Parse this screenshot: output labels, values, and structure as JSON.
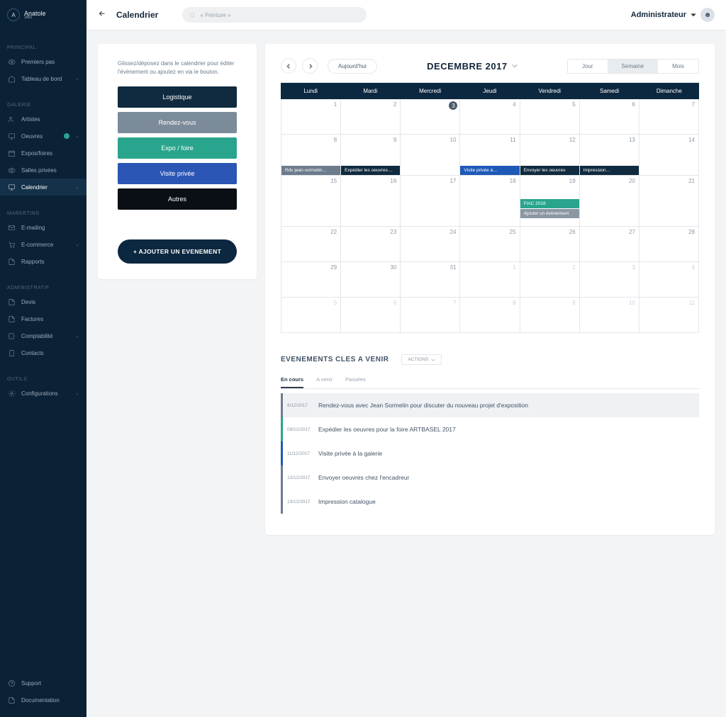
{
  "brand": {
    "name": "Anatole",
    "sub": "1883"
  },
  "header": {
    "page_title": "Calendrier",
    "search_placeholder": "« Peinture »",
    "user_label": "Administrateur"
  },
  "sidebar": {
    "sections": [
      {
        "title": "PRINCIPAL",
        "items": [
          {
            "label": "Premiers pas",
            "icon": "eye"
          },
          {
            "label": "Tableau de bord",
            "icon": "home",
            "chev": true
          }
        ]
      },
      {
        "title": "GALERIE",
        "items": [
          {
            "label": "Artistes",
            "icon": "users"
          },
          {
            "label": "Oeuvres",
            "icon": "monitor",
            "badge": true,
            "chev": true
          },
          {
            "label": "Expos/foires",
            "icon": "calendar"
          },
          {
            "label": "Salles privées",
            "icon": "eye"
          },
          {
            "label": "Calendrier",
            "icon": "monitor",
            "active": true,
            "chev": true
          }
        ]
      },
      {
        "title": "MARKETING",
        "items": [
          {
            "label": "E-mailing",
            "icon": "mail"
          },
          {
            "label": "E-commerce",
            "icon": "cart",
            "chev": true
          },
          {
            "label": "Rapports",
            "icon": "file"
          }
        ]
      },
      {
        "title": "ADMINISTRATIF",
        "items": [
          {
            "label": "Devis",
            "icon": "file"
          },
          {
            "label": "Factures",
            "icon": "file"
          },
          {
            "label": "Comptabilité",
            "icon": "book",
            "chev": true
          },
          {
            "label": "Contacts",
            "icon": "tablet"
          }
        ]
      },
      {
        "title": "OUTILS",
        "items": [
          {
            "label": "Configurations",
            "icon": "gear",
            "chev": true
          }
        ]
      }
    ],
    "footer": [
      {
        "label": "Support",
        "icon": "help"
      },
      {
        "label": "Documentation",
        "icon": "file"
      }
    ]
  },
  "left": {
    "desc": "Glissez/déposez dans le calendrier pour éditer l'évènement ou ajoutez en via le bouton.",
    "tags": [
      {
        "label": "Logistique",
        "cls": "tag-logistique"
      },
      {
        "label": "Rendez-vous",
        "cls": "tag-rdv"
      },
      {
        "label": "Expo / foire",
        "cls": "tag-expo"
      },
      {
        "label": "Visite privée",
        "cls": "tag-visite"
      },
      {
        "label": "Autres",
        "cls": "tag-autres"
      }
    ],
    "add": "+ AJOUTER UN EVENEMENT"
  },
  "calendar": {
    "today": "Aujourd'hui",
    "title": "DECEMBRE 2017",
    "views": {
      "day": "Jour",
      "week": "Semaine",
      "month": "Mois",
      "active": "Semaine"
    },
    "weekdays": [
      "Lundi",
      "Mardi",
      "Mercredi",
      "Jeudi",
      "Vendredi",
      "Samedi",
      "Dimanche"
    ],
    "rows": [
      {
        "days": [
          {
            "n": 1
          },
          {
            "n": 2
          },
          {
            "n": 3,
            "today": true
          },
          {
            "n": 4
          },
          {
            "n": 5
          },
          {
            "n": 6
          },
          {
            "n": 7
          }
        ]
      },
      {
        "cls": "week-2 row2",
        "days": [
          {
            "n": 8
          },
          {
            "n": 9
          },
          {
            "n": 10
          },
          {
            "n": 11
          },
          {
            "n": 12
          },
          {
            "n": 13
          },
          {
            "n": 14
          }
        ],
        "events": [
          {
            "col": 0,
            "span": 1,
            "color": "#6d7c8c",
            "label": "Rdv jean-sormelin…",
            "slot": "a"
          },
          {
            "col": 1,
            "span": 1,
            "color": "#102a3f",
            "label": "Expédier les oeuvres…",
            "slot": "a"
          },
          {
            "col": 3,
            "span": 1,
            "color": "#1e59b8",
            "label": "Visite privée à…",
            "slot": "a"
          },
          {
            "col": 4,
            "span": 1,
            "color": "#102a3f",
            "label": "Envoyer les oeuvres",
            "slot": "a"
          },
          {
            "col": 5,
            "span": 1,
            "color": "#102a3f",
            "label": "Impression…",
            "slot": "a"
          }
        ]
      },
      {
        "cls": "week-3 row3",
        "days": [
          {
            "n": 15
          },
          {
            "n": 16
          },
          {
            "n": 17
          },
          {
            "n": 18
          },
          {
            "n": 19
          },
          {
            "n": 20
          },
          {
            "n": 21
          }
        ],
        "events": [
          {
            "col": 4,
            "span": 1,
            "color": "#29a58d",
            "label": "FIAC 2018",
            "slot": "a"
          },
          {
            "col": 4,
            "span": 1,
            "color": "#8a96a3",
            "label": "Ajouter un évènement",
            "slot": "b"
          }
        ]
      },
      {
        "days": [
          {
            "n": 22
          },
          {
            "n": 23
          },
          {
            "n": 24
          },
          {
            "n": 25
          },
          {
            "n": 26
          },
          {
            "n": 27
          },
          {
            "n": 28
          }
        ]
      },
      {
        "days": [
          {
            "n": 29
          },
          {
            "n": 30
          },
          {
            "n": 31
          },
          {
            "n": 1,
            "dim": true
          },
          {
            "n": 2,
            "dim": true
          },
          {
            "n": 3,
            "dim": true
          },
          {
            "n": 4,
            "dim": true
          }
        ]
      },
      {
        "days": [
          {
            "n": 5,
            "dim": true
          },
          {
            "n": 6,
            "dim": true
          },
          {
            "n": 7,
            "dim": true
          },
          {
            "n": 8,
            "dim": true
          },
          {
            "n": 9,
            "dim": true
          },
          {
            "n": 10,
            "dim": true
          },
          {
            "n": 11,
            "dim": true
          }
        ]
      }
    ]
  },
  "upcoming": {
    "title": "EVENEMENTS CLES A VENIR",
    "actions": "ACTIONS",
    "tabs": [
      {
        "label": "En cours",
        "active": true
      },
      {
        "label": "A venir"
      },
      {
        "label": "Passées"
      }
    ],
    "items": [
      {
        "date": "8/12/2017",
        "text": "Rendez-vous avec Jean Sormelin pour discuter du nouveau projet d'exposition",
        "color": "#6d7c8c",
        "hl": true
      },
      {
        "date": "09/12/2017",
        "text": "Expédier les oeuvres pour la foire ARTBASEL 2017",
        "color": "#29a58d"
      },
      {
        "date": "11/12/2017",
        "text": "Visite privée à la galerie",
        "color": "#1e59b8"
      },
      {
        "date": "12/12/2017",
        "text": "Envoyer oeuvres chez l'encadreur",
        "color": "#6d7c8c"
      },
      {
        "date": "13/12/2017",
        "text": "Impression catalogue",
        "color": "#6d7c8c"
      }
    ]
  }
}
